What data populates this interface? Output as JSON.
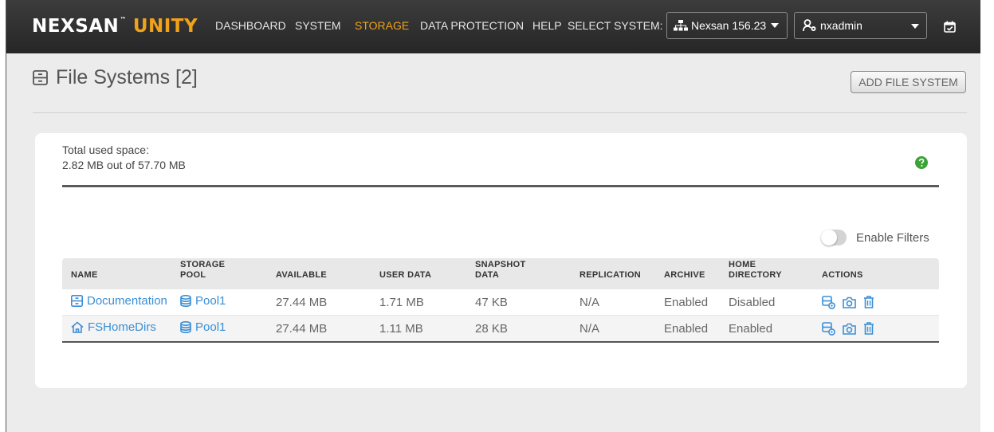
{
  "brand": {
    "name": "NEXSAN",
    "tm": "™",
    "product": "UNITY"
  },
  "nav": {
    "items": [
      {
        "label": "DASHBOARD"
      },
      {
        "label": "SYSTEM"
      },
      {
        "label": "STORAGE"
      },
      {
        "label": "DATA PROTECTION"
      },
      {
        "label": "HELP"
      }
    ],
    "active": "STORAGE",
    "select_system_label": "SELECT SYSTEM:",
    "system": "Nexsan 156.23",
    "user": "nxadmin"
  },
  "page": {
    "title": "File Systems [2]",
    "add_button": "ADD FILE SYSTEM"
  },
  "usage": {
    "label": "Total used space:",
    "value": "2.82 MB out of 57.70 MB"
  },
  "filters": {
    "label": "Enable Filters",
    "enabled": false
  },
  "table": {
    "headers": [
      {
        "l1": "",
        "l2": "NAME"
      },
      {
        "l1": "STORAGE",
        "l2": "POOL"
      },
      {
        "l1": "",
        "l2": "AVAILABLE"
      },
      {
        "l1": "",
        "l2": "USER DATA"
      },
      {
        "l1": "SNAPSHOT",
        "l2": "DATA"
      },
      {
        "l1": "",
        "l2": "REPLICATION"
      },
      {
        "l1": "",
        "l2": "ARCHIVE"
      },
      {
        "l1": "HOME",
        "l2": "DIRECTORY"
      },
      {
        "l1": "",
        "l2": "ACTIONS"
      }
    ],
    "rows": [
      {
        "name": "Documentation",
        "name_icon": "file-system-icon",
        "pool": "Pool1",
        "available": "27.44 MB",
        "user_data": "1.71 MB",
        "snapshot_data": "47 KB",
        "replication": "N/A",
        "archive": "Enabled",
        "home_directory": "Disabled"
      },
      {
        "name": "FSHomeDirs",
        "name_icon": "home-icon",
        "pool": "Pool1",
        "available": "27.44 MB",
        "user_data": "1.11 MB",
        "snapshot_data": "28 KB",
        "replication": "N/A",
        "archive": "Enabled",
        "home_directory": "Enabled"
      }
    ]
  },
  "colors": {
    "accent": "#f0a21a",
    "link": "#3a8fd6",
    "topbar": "#2e2e2e",
    "help": "#3aa335"
  }
}
